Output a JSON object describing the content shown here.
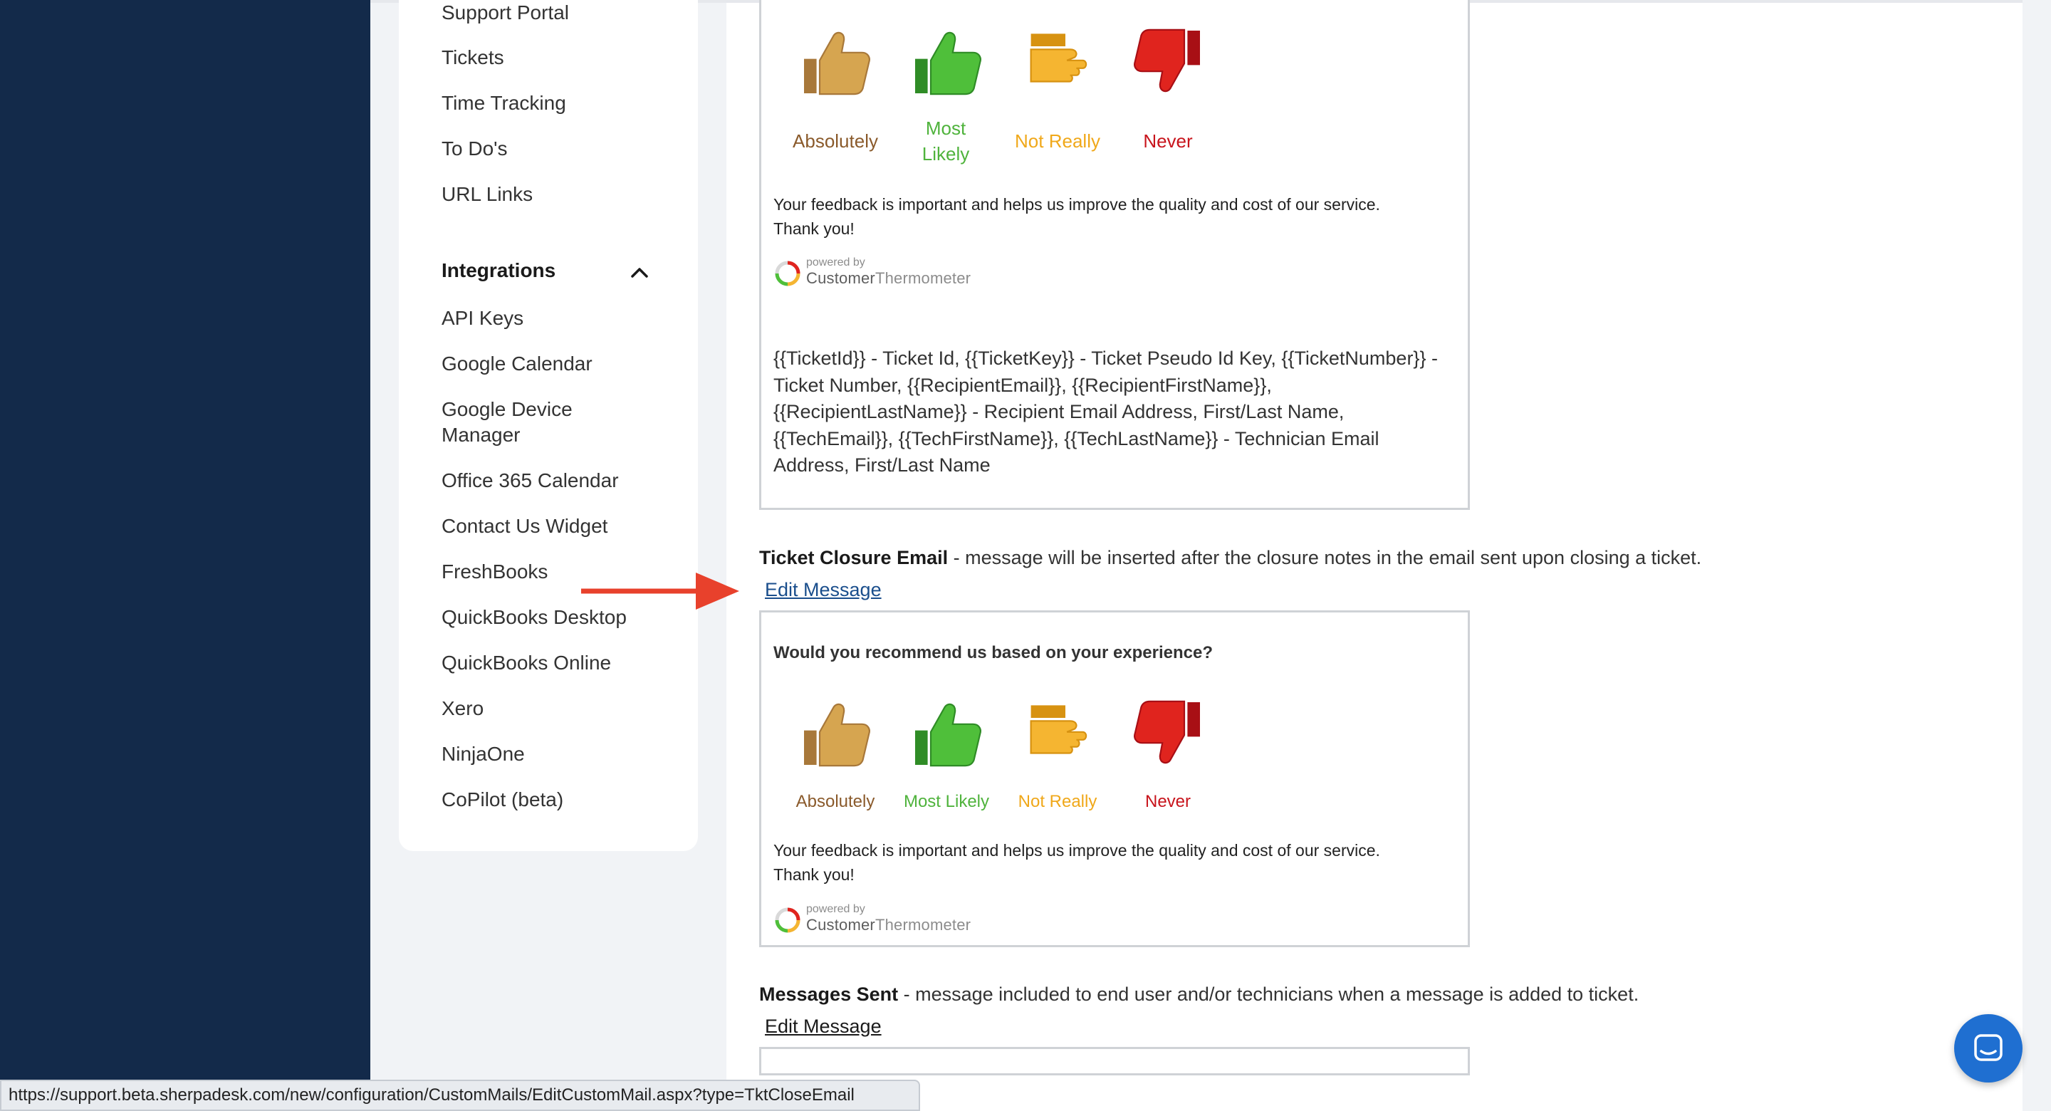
{
  "sidebar": {
    "items_top": [
      "Support Portal",
      "Tickets",
      "Time Tracking",
      "To Do's",
      "URL Links"
    ],
    "section_title": "Integrations",
    "items_integrations": [
      "API Keys",
      "Google Calendar",
      "Google Device Manager",
      "Office 365 Calendar",
      "Contact Us Widget",
      "FreshBooks",
      "QuickBooks Desktop",
      "QuickBooks Online",
      "Xero",
      "NinjaOne",
      "CoPilot (beta)"
    ]
  },
  "ratings": {
    "absolutely": "Absolutely",
    "most_likely": "Most Likely",
    "not_really": "Not Really",
    "never": "Never"
  },
  "feedback_text": "Your feedback is important and helps us improve the quality and cost of our service.",
  "thank_you": "Thank you!",
  "powered": {
    "small": "powered by",
    "name_a": "Customer",
    "name_b": "Thermometer"
  },
  "variables_text": "{{TicketId}} - Ticket Id, {{TicketKey}} - Ticket Pseudo Id Key, {{TicketNumber}} - Ticket Number, {{RecipientEmail}}, {{RecipientFirstName}}, {{RecipientLastName}} - Recipient Email Address, First/Last Name, {{TechEmail}}, {{TechFirstName}}, {{TechLastName}} - Technician Email Address, First/Last Name",
  "ticket_closure": {
    "title": "Ticket Closure Email",
    "description": " - message will be inserted after the closure notes in the email sent upon closing a ticket.",
    "edit_label": "Edit Message",
    "question": "Would you recommend us based on your experience?"
  },
  "messages_sent": {
    "title": "Messages Sent",
    "description": " - message included to end user and/or technicians when a message is added to ticket.",
    "edit_label": "Edit Message"
  },
  "status_url": "https://support.beta.sherpadesk.com/new/configuration/CustomMails/EditCustomMail.aspx?type=TktCloseEmail",
  "colors": {
    "sidebar_dark": "#132a4a",
    "absolutely": "#8a5a2b",
    "most_likely": "#4fb33c",
    "not_really": "#f0a81a",
    "never": "#c8141c",
    "arrow": "#e8412c",
    "chat": "#1f6fd1"
  }
}
